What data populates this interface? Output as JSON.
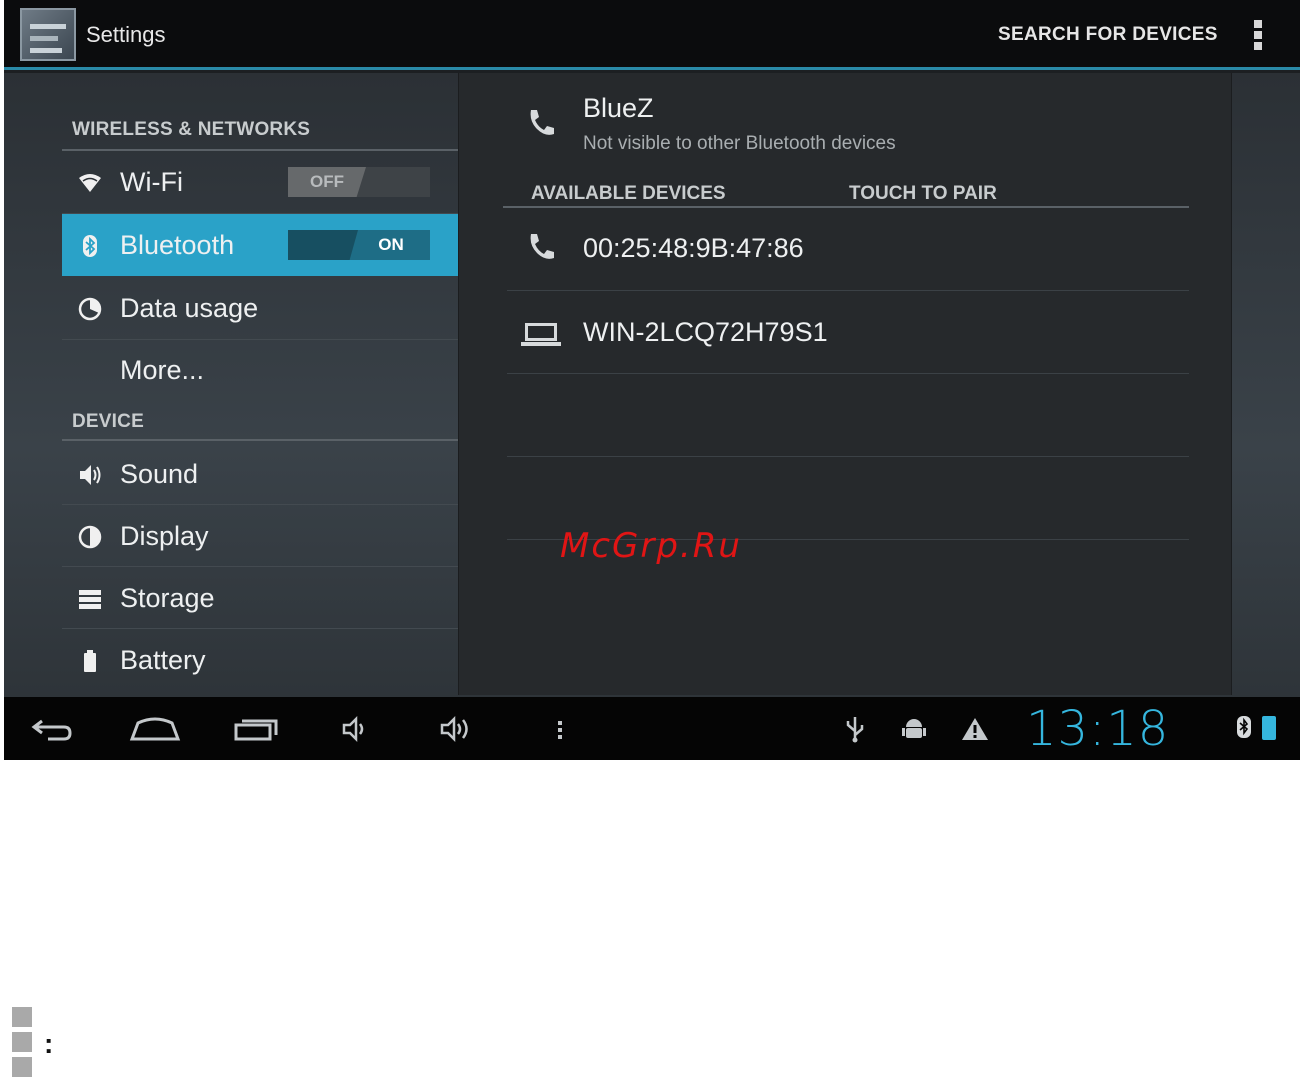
{
  "action_bar": {
    "title": "Settings",
    "search_button": "SEARCH FOR DEVICES"
  },
  "settings_menu": {
    "sections": [
      {
        "header": "WIRELESS & NETWORKS"
      },
      {
        "header": "DEVICE"
      }
    ],
    "items": {
      "wifi": {
        "label": "Wi-Fi",
        "toggle": "OFF"
      },
      "bluetooth": {
        "label": "Bluetooth",
        "toggle": "ON"
      },
      "data_usage": {
        "label": "Data usage"
      },
      "more": {
        "label": "More..."
      },
      "sound": {
        "label": "Sound"
      },
      "display": {
        "label": "Display"
      },
      "storage": {
        "label": "Storage"
      },
      "battery": {
        "label": "Battery"
      }
    }
  },
  "bluetooth_panel": {
    "local_device": {
      "name": "BlueZ",
      "status": "Not visible to other Bluetooth devices"
    },
    "available_header": "AVAILABLE DEVICES",
    "touch_header": "TOUCH TO PAIR",
    "devices": [
      {
        "name": "00:25:48:9B:47:86",
        "icon": "phone-icon"
      },
      {
        "name": "WIN-2LCQ72H79S1",
        "icon": "laptop-icon"
      }
    ]
  },
  "watermark": "McGrp.Ru",
  "system_bar": {
    "clock": "13:18"
  },
  "footnote": {
    "colon": ":"
  },
  "colors": {
    "accent": "#2aa2c8",
    "clock": "#35b6de"
  }
}
